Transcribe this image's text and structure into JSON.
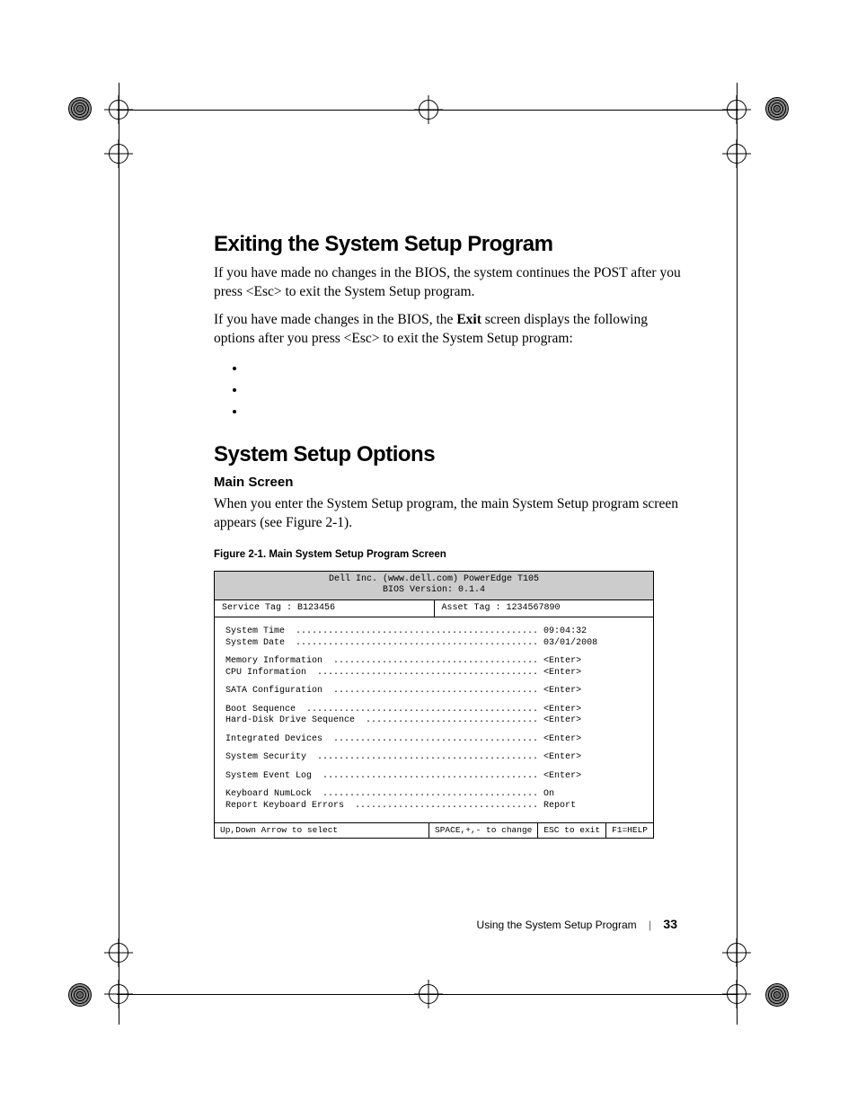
{
  "headings": {
    "h1a": "Exiting the System Setup Program",
    "h1b": "System Setup Options",
    "h2_main": "Main Screen"
  },
  "paragraphs": {
    "p1": "If you have made no changes in the BIOS, the system continues the POST after you press <Esc> to exit the System Setup program.",
    "p2a": "If you have made changes in the BIOS, the ",
    "p2b": "Exit",
    "p2c": " screen displays the following options after you press <Esc> to exit the System Setup program:",
    "p3": "When you enter the System Setup program, the main System Setup program screen appears (see Figure 2-1)."
  },
  "bullets": [
    "",
    "",
    ""
  ],
  "figure_caption": "Figure 2-1.    Main System Setup Program Screen",
  "bios": {
    "header_line1": "Dell Inc. (www.dell.com) PowerEdge T105",
    "header_line2": "BIOS Version: 0.1.4",
    "service_tag_label": "Service Tag : ",
    "service_tag_value": "B123456",
    "asset_tag_label": "Asset Tag : ",
    "asset_tag_value": "1234567890",
    "rows": [
      [
        {
          "label": "System Time",
          "value": "09:04:32"
        },
        {
          "label": "System Date",
          "value": "03/01/2008"
        }
      ],
      [
        {
          "label": "Memory Information",
          "value": "<Enter>"
        },
        {
          "label": "CPU Information",
          "value": "<Enter>"
        }
      ],
      [
        {
          "label": "SATA Configuration",
          "value": "<Enter>"
        }
      ],
      [
        {
          "label": "Boot Sequence",
          "value": "<Enter>"
        },
        {
          "label": "Hard-Disk Drive Sequence",
          "value": "<Enter>"
        }
      ],
      [
        {
          "label": "Integrated Devices",
          "value": "<Enter>"
        }
      ],
      [
        {
          "label": "System Security",
          "value": "<Enter>"
        }
      ],
      [
        {
          "label": "System Event Log",
          "value": "<Enter>"
        }
      ],
      [
        {
          "label": "Keyboard NumLock",
          "value": "On"
        },
        {
          "label": "Report Keyboard Errors",
          "value": "Report"
        }
      ]
    ],
    "footer": {
      "f1": "Up,Down Arrow to select",
      "f2": "SPACE,+,- to change",
      "f3": "ESC to exit",
      "f4": "F1=HELP"
    }
  },
  "page_footer": {
    "section": "Using the System Setup Program",
    "page": "33"
  }
}
